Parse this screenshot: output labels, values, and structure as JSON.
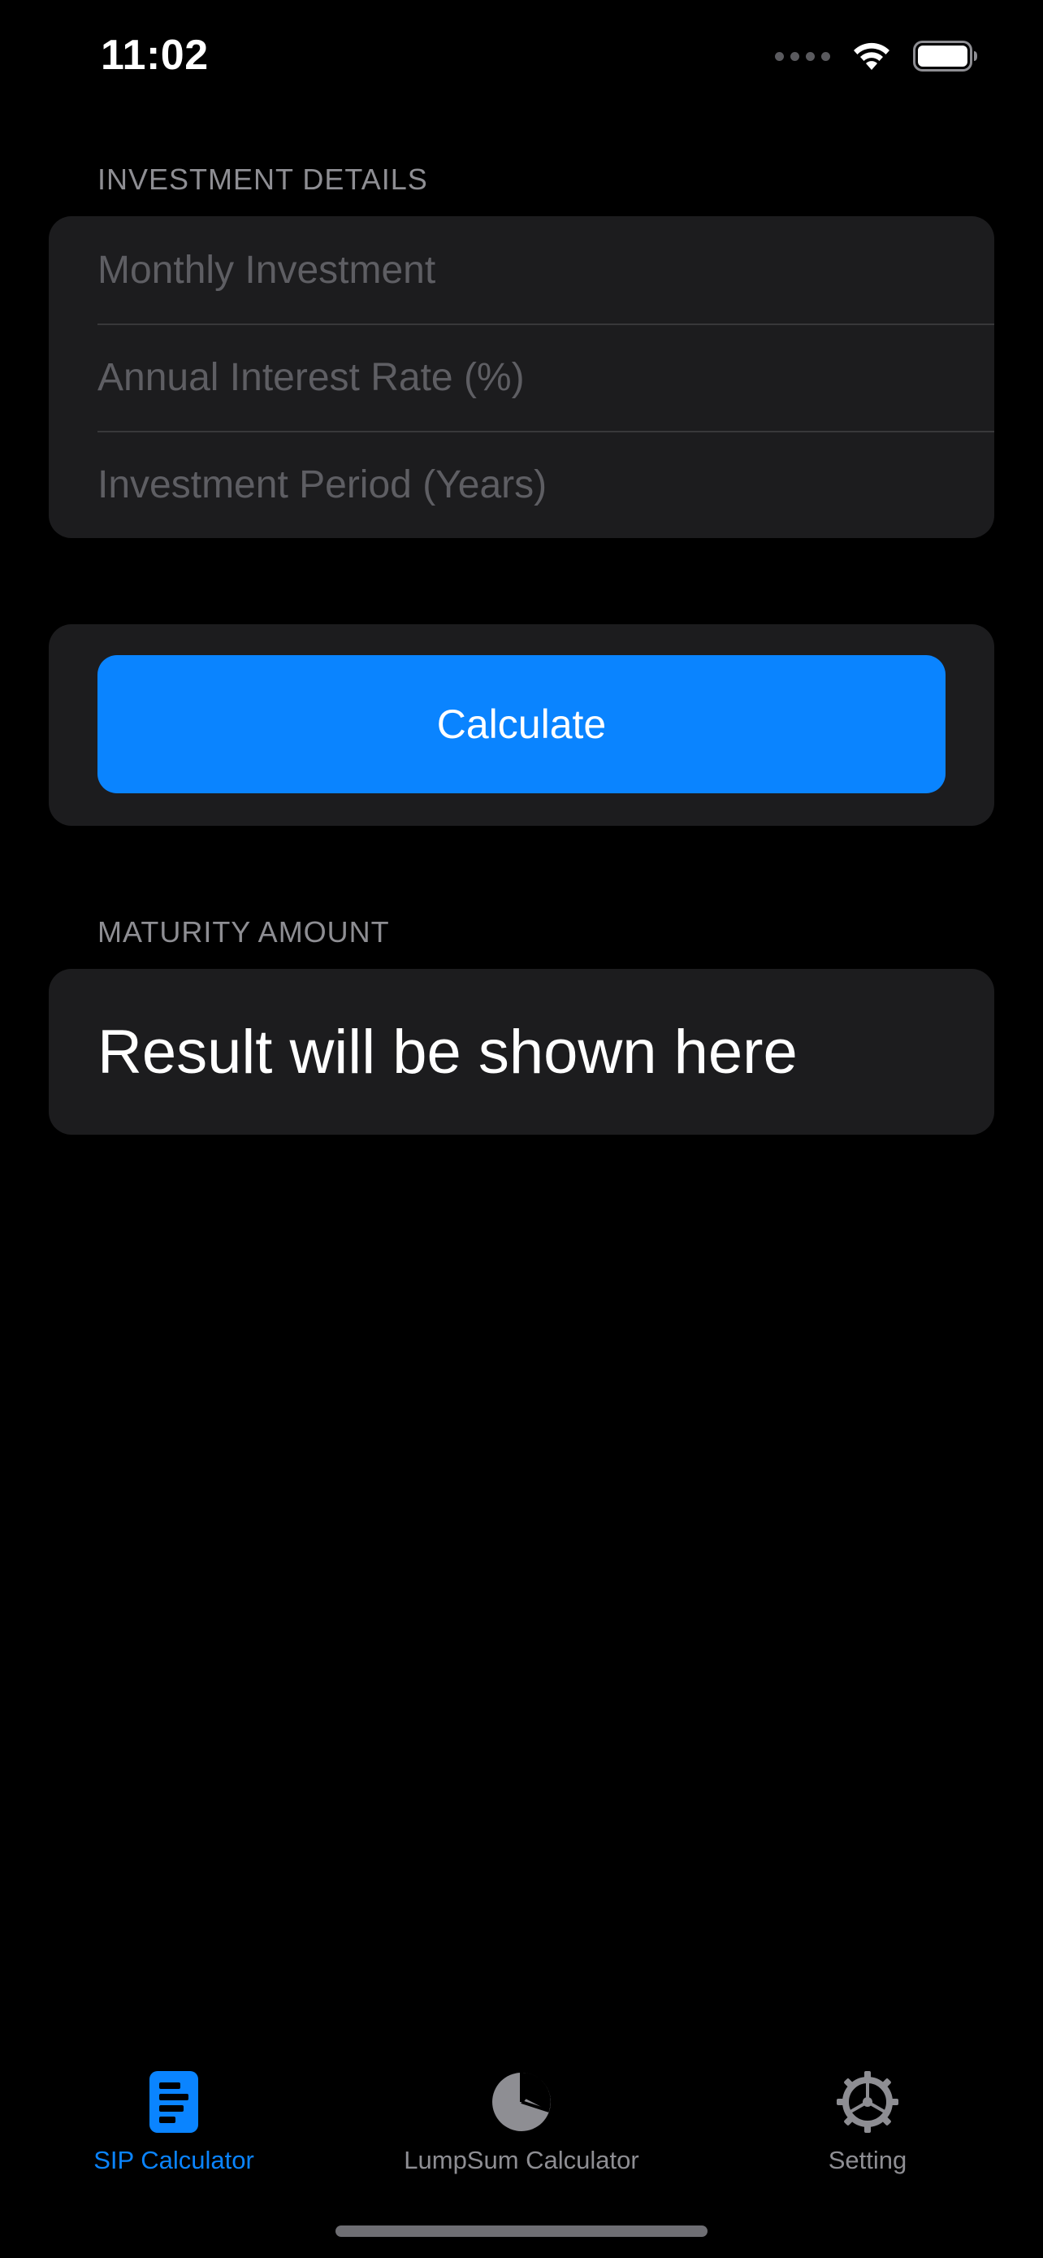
{
  "status_bar": {
    "time": "11:02"
  },
  "investment_section": {
    "header": "INVESTMENT DETAILS",
    "fields": [
      {
        "placeholder": "Monthly Investment",
        "value": ""
      },
      {
        "placeholder": "Annual Interest Rate (%)",
        "value": ""
      },
      {
        "placeholder": "Investment Period (Years)",
        "value": ""
      }
    ]
  },
  "calculate_button": {
    "label": "Calculate"
  },
  "maturity_section": {
    "header": "MATURITY AMOUNT",
    "result": "Result will be shown here"
  },
  "tab_bar": {
    "tabs": [
      {
        "label": "SIP Calculator",
        "icon": "document-list-icon",
        "active": true
      },
      {
        "label": "LumpSum Calculator",
        "icon": "pie-chart-icon",
        "active": false
      },
      {
        "label": "Setting",
        "icon": "gear-icon",
        "active": false
      }
    ]
  },
  "colors": {
    "accent": "#0a84ff",
    "background": "#000000",
    "card": "#1c1c1e",
    "secondary_text": "#8e8e93"
  }
}
